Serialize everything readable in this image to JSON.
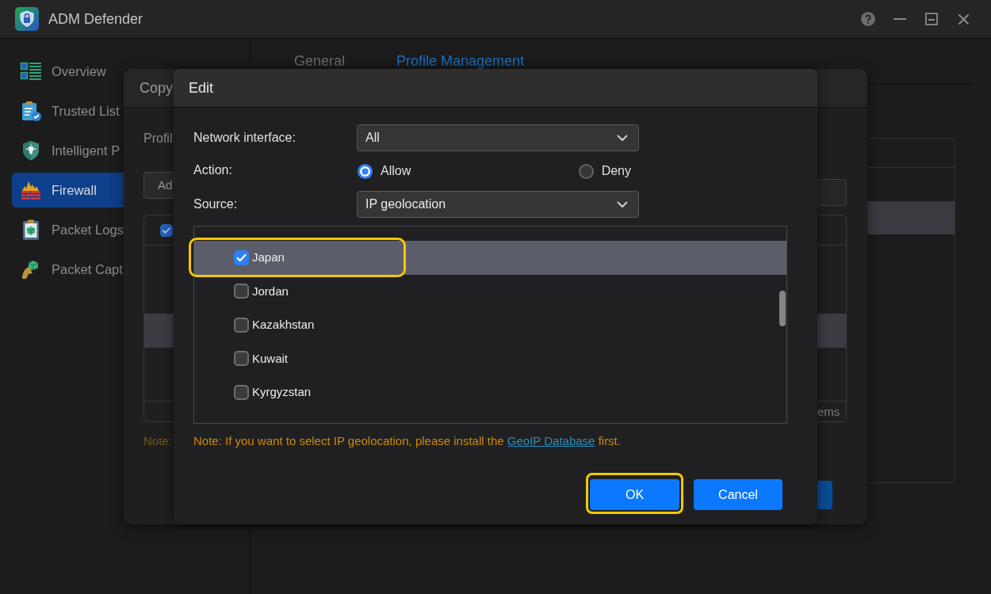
{
  "window": {
    "title": "ADM Defender"
  },
  "sidebar": {
    "items": [
      {
        "label": "Overview",
        "selected": false
      },
      {
        "label": "Trusted List",
        "selected": false
      },
      {
        "label": "Intelligent P",
        "selected": false
      },
      {
        "label": "Firewall",
        "selected": true
      },
      {
        "label": "Packet Logs",
        "selected": false
      },
      {
        "label": "Packet Capt",
        "selected": false
      }
    ]
  },
  "tabs": [
    {
      "label": "General",
      "selected": false
    },
    {
      "label": "Profile Management",
      "selected": true
    }
  ],
  "main_table": {
    "rows": [
      {
        "selected": false
      },
      {
        "selected": true
      }
    ]
  },
  "copy_dialog": {
    "title": "Copy",
    "field_label": "Profil",
    "button": "Ad",
    "table": {
      "header_checked": true,
      "rows": [
        {
          "selected": false
        },
        {
          "selected": false
        },
        {
          "selected": true
        }
      ],
      "footer": "ems"
    },
    "note": "Note:"
  },
  "edit_dialog": {
    "title": "Edit",
    "fields": [
      {
        "kind": "select",
        "label": "Network interface:",
        "value": "All"
      },
      {
        "kind": "radio",
        "label": "Action:",
        "options": [
          {
            "label": "Allow",
            "selected": true
          },
          {
            "label": "Deny",
            "selected": false
          }
        ]
      },
      {
        "kind": "select",
        "label": "Source:",
        "value": "IP geolocation"
      }
    ],
    "countries": [
      {
        "label": "Japan",
        "checked": true,
        "selected": true,
        "highlighted": true
      },
      {
        "label": "Jordan",
        "checked": false,
        "selected": false,
        "highlighted": false
      },
      {
        "label": "Kazakhstan",
        "checked": false,
        "selected": false,
        "highlighted": false
      },
      {
        "label": "Kuwait",
        "checked": false,
        "selected": false,
        "highlighted": false
      },
      {
        "label": "Kyrgyzstan",
        "checked": false,
        "selected": false,
        "highlighted": false
      }
    ],
    "note": {
      "text": "Note: If you want to select IP geolocation, please install the",
      "link": "GeoIP Database",
      "text_after": "first."
    },
    "buttons": [
      {
        "label": "OK",
        "highlighted": true
      },
      {
        "label": "Cancel",
        "highlighted": false
      }
    ]
  }
}
